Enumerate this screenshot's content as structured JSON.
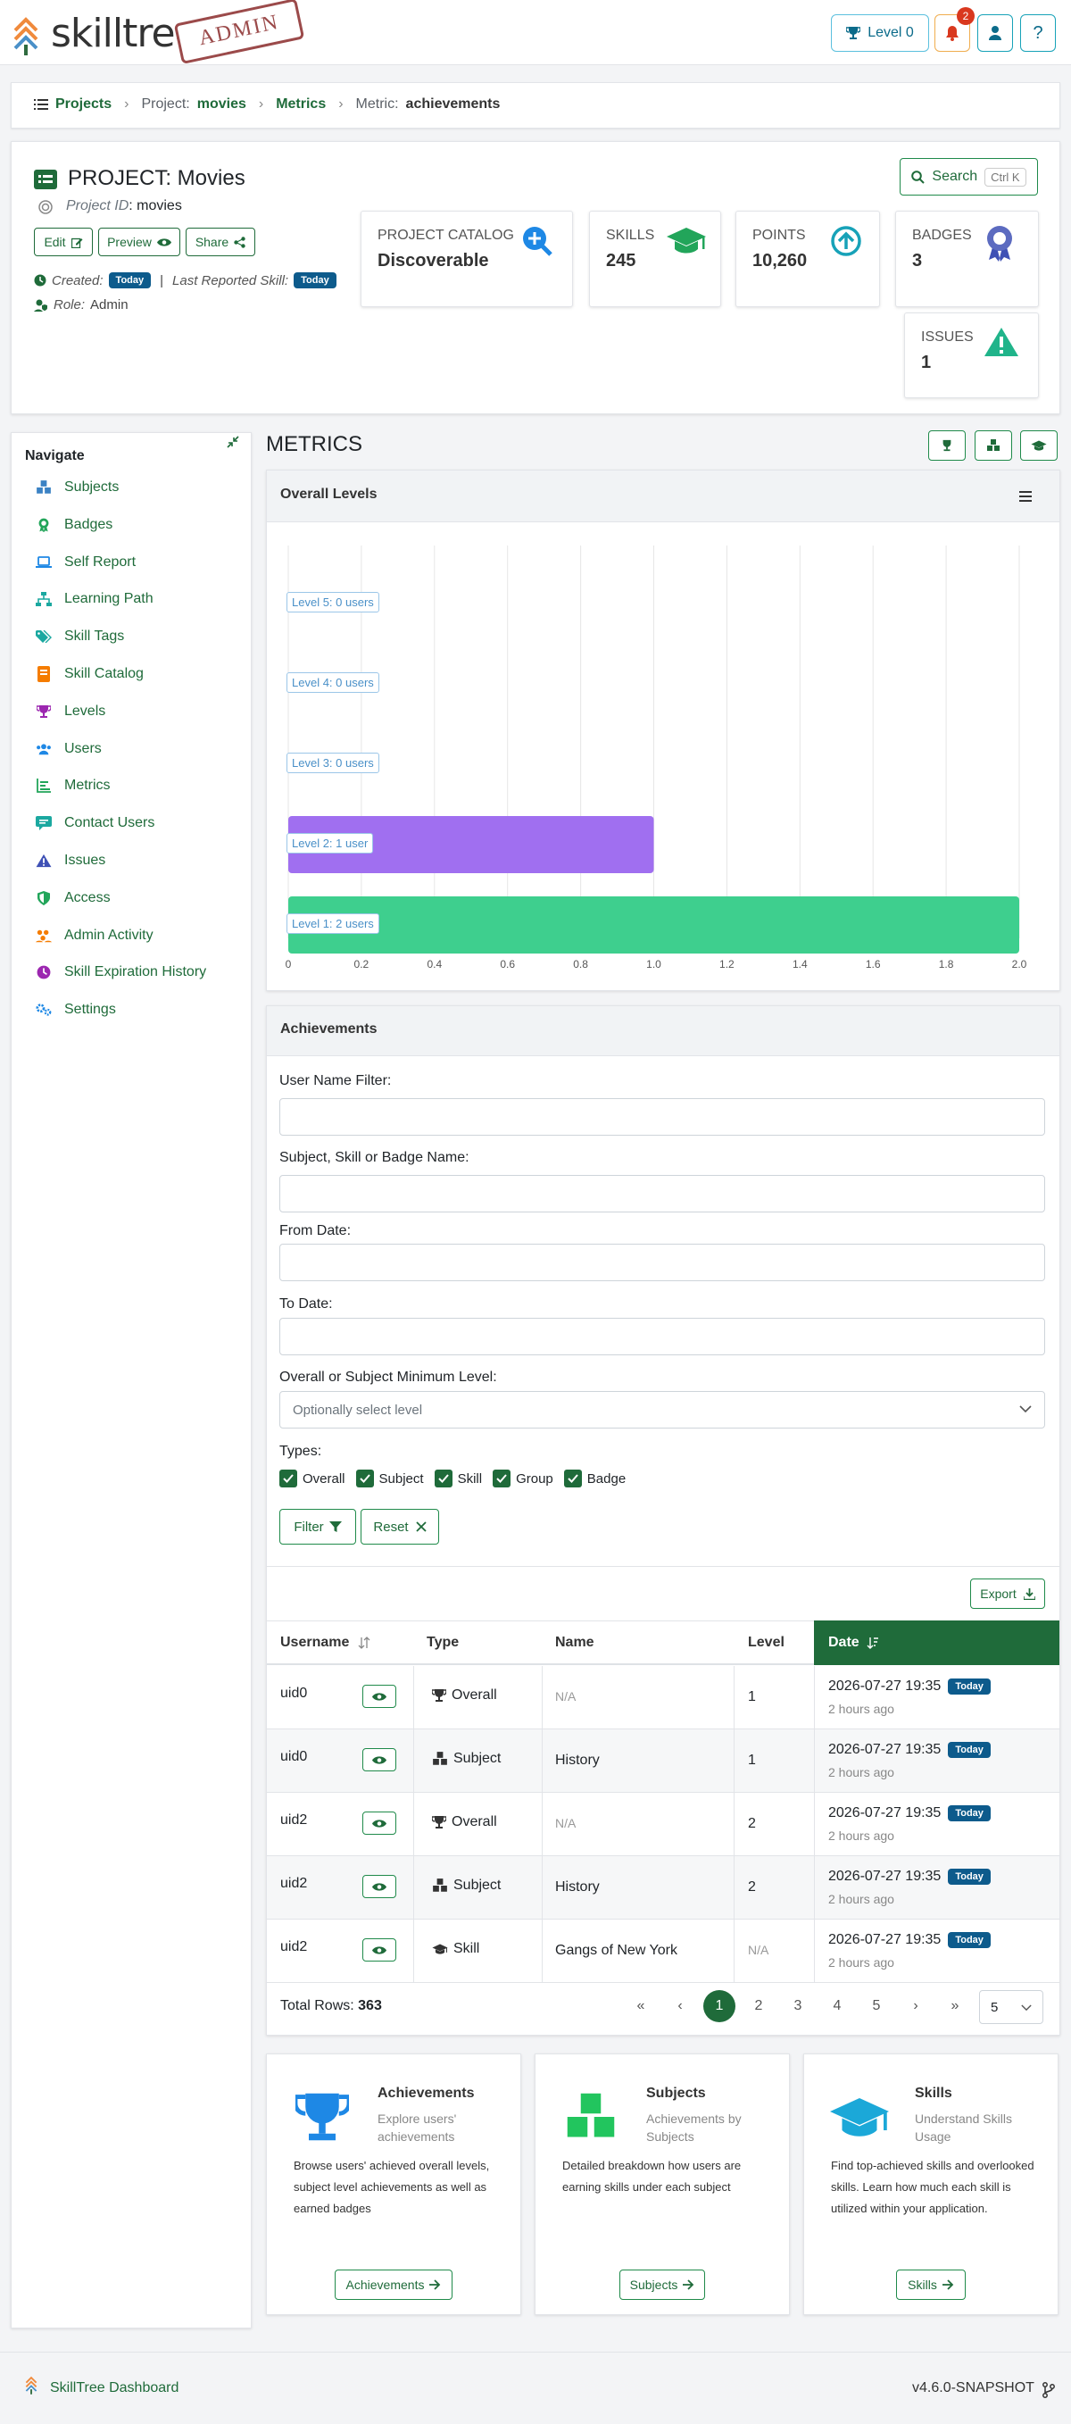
{
  "app": {
    "name": "skilltree",
    "stamp": "ADMIN"
  },
  "topbar": {
    "level_label": "Level 0",
    "notifications_count": "2",
    "help_label": "?"
  },
  "breadcrumb": {
    "projects": "Projects",
    "project_prefix": "Project:",
    "project": "movies",
    "metrics": "Metrics",
    "metric_prefix": "Metric:",
    "metric": "achievements"
  },
  "project": {
    "title": "PROJECT: Movies",
    "id_label": "Project ID",
    "id_value": ": movies",
    "edit_label": "Edit",
    "preview_label": "Preview",
    "share_label": "Share",
    "created_label": "Created:",
    "created_value": "Today",
    "last_reported_label": "Last Reported Skill:",
    "last_reported_value": "Today",
    "role_label": "Role:",
    "role_value": "Admin",
    "search_label": "Search",
    "search_shortcut": "Ctrl K"
  },
  "stats": [
    {
      "label": "PROJECT CATALOG",
      "value": "Discoverable"
    },
    {
      "label": "SKILLS",
      "value": "245"
    },
    {
      "label": "POINTS",
      "value": "10,260"
    },
    {
      "label": "BADGES",
      "value": "3"
    },
    {
      "label": "ISSUES",
      "value": "1"
    }
  ],
  "nav": {
    "title": "Navigate",
    "items": [
      {
        "label": "Subjects",
        "icon": "cubes-icon",
        "color": "#3b82c4"
      },
      {
        "label": "Badges",
        "icon": "award-icon",
        "color": "#22a55a"
      },
      {
        "label": "Self Report",
        "icon": "laptop-icon",
        "color": "#1e88e5"
      },
      {
        "label": "Learning Path",
        "icon": "network-icon",
        "color": "#1ba8a0"
      },
      {
        "label": "Skill Tags",
        "icon": "tags-icon",
        "color": "#1ba8a0"
      },
      {
        "label": "Skill Catalog",
        "icon": "book-icon",
        "color": "#f57c00"
      },
      {
        "label": "Levels",
        "icon": "trophy-icon",
        "color": "#9c27b0"
      },
      {
        "label": "Users",
        "icon": "users-icon",
        "color": "#1e88e5"
      },
      {
        "label": "Metrics",
        "icon": "chart-icon",
        "color": "#22a55a"
      },
      {
        "label": "Contact Users",
        "icon": "contact-icon",
        "color": "#1ba8a0"
      },
      {
        "label": "Issues",
        "icon": "warning-icon",
        "color": "#3f51b5"
      },
      {
        "label": "Access",
        "icon": "shield-icon",
        "color": "#22a55a"
      },
      {
        "label": "Admin Activity",
        "icon": "activity-icon",
        "color": "#f57c00"
      },
      {
        "label": "Skill Expiration History",
        "icon": "clock-icon",
        "color": "#9c27b0"
      },
      {
        "label": "Settings",
        "icon": "gears-icon",
        "color": "#1e88e5"
      }
    ]
  },
  "metrics": {
    "title": "METRICS"
  },
  "chart_panel": {
    "title": "Overall Levels"
  },
  "chart_data": {
    "type": "bar",
    "orientation": "horizontal",
    "title": "Overall Levels",
    "categories": [
      "Level 5",
      "Level 4",
      "Level 3",
      "Level 2",
      "Level 1"
    ],
    "values": [
      0,
      0,
      0,
      1,
      2
    ],
    "data_labels": [
      "Level 5: 0 users",
      "Level 4: 0 users",
      "Level 3: 0 users",
      "Level 2: 1 user",
      "Level 1: 2 users"
    ],
    "colors": [
      "#3ecf8e",
      "#3ecf8e",
      "#3ecf8e",
      "#a06ff0",
      "#3ecf8e"
    ],
    "xlim": [
      0,
      2.0
    ],
    "x_ticks": [
      "0",
      "0.2",
      "0.4",
      "0.6",
      "0.8",
      "1.0",
      "1.2",
      "1.4",
      "1.6",
      "1.8",
      "2.0"
    ],
    "grid": true
  },
  "achievements": {
    "title": "Achievements",
    "user_filter_label": "User Name Filter:",
    "name_filter_label": "Subject, Skill or Badge Name:",
    "from_label": "From Date:",
    "to_label": "To Date:",
    "level_label": "Overall or Subject Minimum Level:",
    "level_placeholder": "Optionally select level",
    "types_label": "Types:",
    "types": [
      "Overall",
      "Subject",
      "Skill",
      "Group",
      "Badge"
    ],
    "filter_label": "Filter",
    "reset_label": "Reset",
    "export_label": "Export",
    "columns": [
      "Username",
      "Type",
      "Name",
      "Level",
      "Date"
    ],
    "rows": [
      {
        "user": "uid0",
        "type": "Overall",
        "type_icon": "trophy-icon",
        "name": "N/A",
        "name_muted": true,
        "level": "1",
        "level_muted": false,
        "date": "2026-07-27 19:35",
        "ago": "2 hours ago",
        "badge": "Today"
      },
      {
        "user": "uid0",
        "type": "Subject",
        "type_icon": "cubes-icon",
        "name": "History",
        "name_muted": false,
        "level": "1",
        "level_muted": false,
        "date": "2026-07-27 19:35",
        "ago": "2 hours ago",
        "badge": "Today"
      },
      {
        "user": "uid2",
        "type": "Overall",
        "type_icon": "trophy-icon",
        "name": "N/A",
        "name_muted": true,
        "level": "2",
        "level_muted": false,
        "date": "2026-07-27 19:35",
        "ago": "2 hours ago",
        "badge": "Today"
      },
      {
        "user": "uid2",
        "type": "Subject",
        "type_icon": "cubes-icon",
        "name": "History",
        "name_muted": false,
        "level": "2",
        "level_muted": false,
        "date": "2026-07-27 19:35",
        "ago": "2 hours ago",
        "badge": "Today"
      },
      {
        "user": "uid2",
        "type": "Skill",
        "type_icon": "graduation-cap-icon",
        "name": "Gangs of New York",
        "name_muted": false,
        "level": "N/A",
        "level_muted": true,
        "date": "2026-07-27 19:35",
        "ago": "2 hours ago",
        "badge": "Today"
      }
    ],
    "total_rows_label": "Total Rows:",
    "total_rows": "363",
    "pagination": {
      "first": "«",
      "prev": "‹",
      "pages": [
        "1",
        "2",
        "3",
        "4",
        "5"
      ],
      "next": "›",
      "last": "»",
      "active": "1",
      "page_size": "5"
    }
  },
  "cards": [
    {
      "title": "Achievements",
      "subtitle": "Explore users' achievements",
      "desc": "Browse users' achieved overall levels, subject level achievements as well as earned badges",
      "button": "Achievements",
      "icon": "trophy-icon",
      "color": "#1e88e5"
    },
    {
      "title": "Subjects",
      "subtitle": "Achievements by Subjects",
      "desc": "Detailed breakdown how users are earning skills under each subject",
      "button": "Subjects",
      "icon": "cubes-icon",
      "color": "#22c55e"
    },
    {
      "title": "Skills",
      "subtitle": "Understand Skills Usage",
      "desc": "Find top-achieved skills and overlooked skills. Learn how much each skill is utilized within your application.",
      "button": "Skills",
      "icon": "graduation-cap-icon",
      "color": "#1ba8d8"
    }
  ],
  "footer": {
    "name": "SkillTree Dashboard",
    "version": "v4.6.0-SNAPSHOT"
  }
}
